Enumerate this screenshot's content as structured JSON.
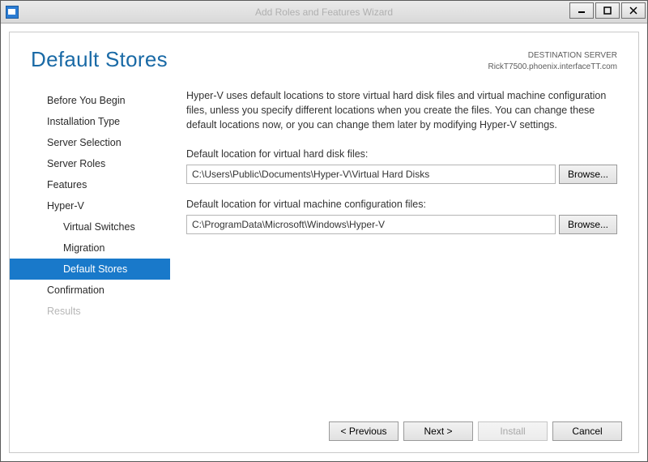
{
  "window": {
    "title": "Add Roles and Features Wizard"
  },
  "header": {
    "page_title": "Default Stores",
    "dest_label": "DESTINATION SERVER",
    "dest_server": "RickT7500.phoenix.interfaceTT.com"
  },
  "nav": {
    "items": [
      {
        "label": "Before You Begin",
        "level": 0
      },
      {
        "label": "Installation Type",
        "level": 0
      },
      {
        "label": "Server Selection",
        "level": 0
      },
      {
        "label": "Server Roles",
        "level": 0
      },
      {
        "label": "Features",
        "level": 0
      },
      {
        "label": "Hyper-V",
        "level": 0
      },
      {
        "label": "Virtual Switches",
        "level": 1
      },
      {
        "label": "Migration",
        "level": 1
      },
      {
        "label": "Default Stores",
        "level": 1,
        "selected": true
      },
      {
        "label": "Confirmation",
        "level": 0
      },
      {
        "label": "Results",
        "level": 0,
        "disabled": true
      }
    ]
  },
  "main": {
    "intro": "Hyper-V uses default locations to store virtual hard disk files and virtual machine configuration files, unless you specify different locations when you create the files. You can change these default locations now, or you can change them later by modifying Hyper-V settings.",
    "vhd_label": "Default location for virtual hard disk files:",
    "vhd_path": "C:\\Users\\Public\\Documents\\Hyper-V\\Virtual Hard Disks",
    "vmcfg_label": "Default location for virtual machine configuration files:",
    "vmcfg_path": "C:\\ProgramData\\Microsoft\\Windows\\Hyper-V",
    "browse_label": "Browse..."
  },
  "footer": {
    "previous": "< Previous",
    "next": "Next >",
    "install": "Install",
    "cancel": "Cancel"
  }
}
